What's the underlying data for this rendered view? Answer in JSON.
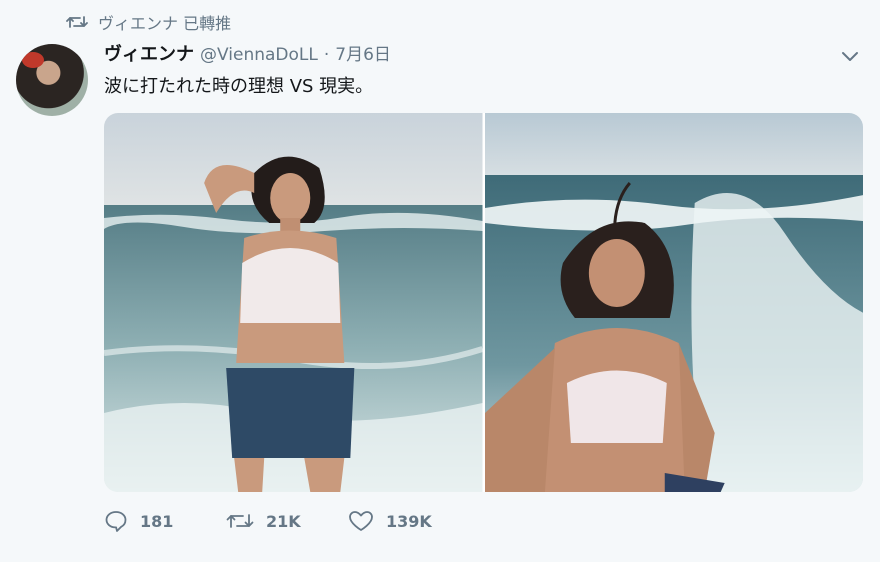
{
  "retweet": {
    "label": "ヴィエンナ 已轉推"
  },
  "tweet": {
    "name": "ヴィエンナ",
    "handle": "@ViennaDoLL",
    "separator": "·",
    "date": "7月6日",
    "text": "波に打たれた時の理想 VS 現実。"
  },
  "actions": {
    "replies": "181",
    "retweets": "21K",
    "likes": "139K"
  },
  "colors": {
    "muted": "#657786",
    "background": "#f5f8fa",
    "text": "#14171a"
  },
  "icons": [
    "retweet-icon",
    "chevron-down-icon",
    "reply-icon",
    "heart-icon"
  ]
}
